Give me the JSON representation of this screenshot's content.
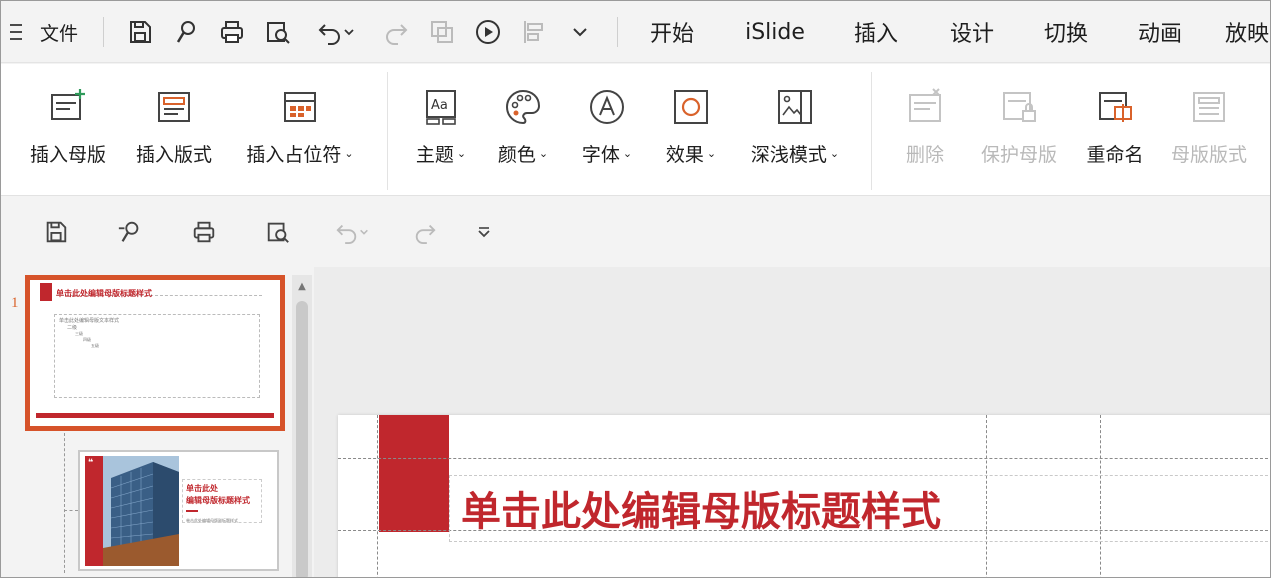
{
  "menubar": {
    "file_label": "文件",
    "tabs": [
      "开始",
      "iSlide",
      "插入",
      "设计",
      "切换",
      "动画",
      "放映"
    ]
  },
  "ribbon": {
    "buttons": [
      {
        "label": "插入母版",
        "icon": "insert-master-icon",
        "dropdown": false,
        "enabled": true
      },
      {
        "label": "插入版式",
        "icon": "insert-layout-icon",
        "dropdown": false,
        "enabled": true
      },
      {
        "label": "插入占位符",
        "icon": "insert-placeholder-icon",
        "dropdown": true,
        "enabled": true
      },
      {
        "label": "主题",
        "icon": "theme-icon",
        "dropdown": true,
        "enabled": true
      },
      {
        "label": "颜色",
        "icon": "palette-icon",
        "dropdown": true,
        "enabled": true
      },
      {
        "label": "字体",
        "icon": "font-icon",
        "dropdown": true,
        "enabled": true
      },
      {
        "label": "效果",
        "icon": "effect-icon",
        "dropdown": true,
        "enabled": true
      },
      {
        "label": "深浅模式",
        "icon": "light-dark-mode-icon",
        "dropdown": true,
        "enabled": true
      },
      {
        "label": "删除",
        "icon": "delete-master-icon",
        "dropdown": false,
        "enabled": false
      },
      {
        "label": "保护母版",
        "icon": "protect-master-icon",
        "dropdown": false,
        "enabled": false
      },
      {
        "label": "重命名",
        "icon": "rename-icon",
        "dropdown": false,
        "enabled": true
      },
      {
        "label": "母版版式",
        "icon": "master-layout-icon",
        "dropdown": false,
        "enabled": false
      }
    ]
  },
  "thumbnails": {
    "slide1_number": "1",
    "slide1_title": "单击此处编辑母版标题样式",
    "slide1_body": [
      "单击此处编辑母版文本样式",
      "二级",
      "三级",
      "四级",
      "五级"
    ],
    "slide2_title_line1": "单击此处",
    "slide2_title_line2": "编辑母版标题样式",
    "slide2_subtitle": "单击此处编辑母版副标题样式"
  },
  "slide": {
    "title": "单击此处编辑母版标题样式"
  },
  "colors": {
    "accent_red": "#c0272d",
    "selection_orange": "#d6532a",
    "disabled_gray": "#b9b9b9"
  }
}
